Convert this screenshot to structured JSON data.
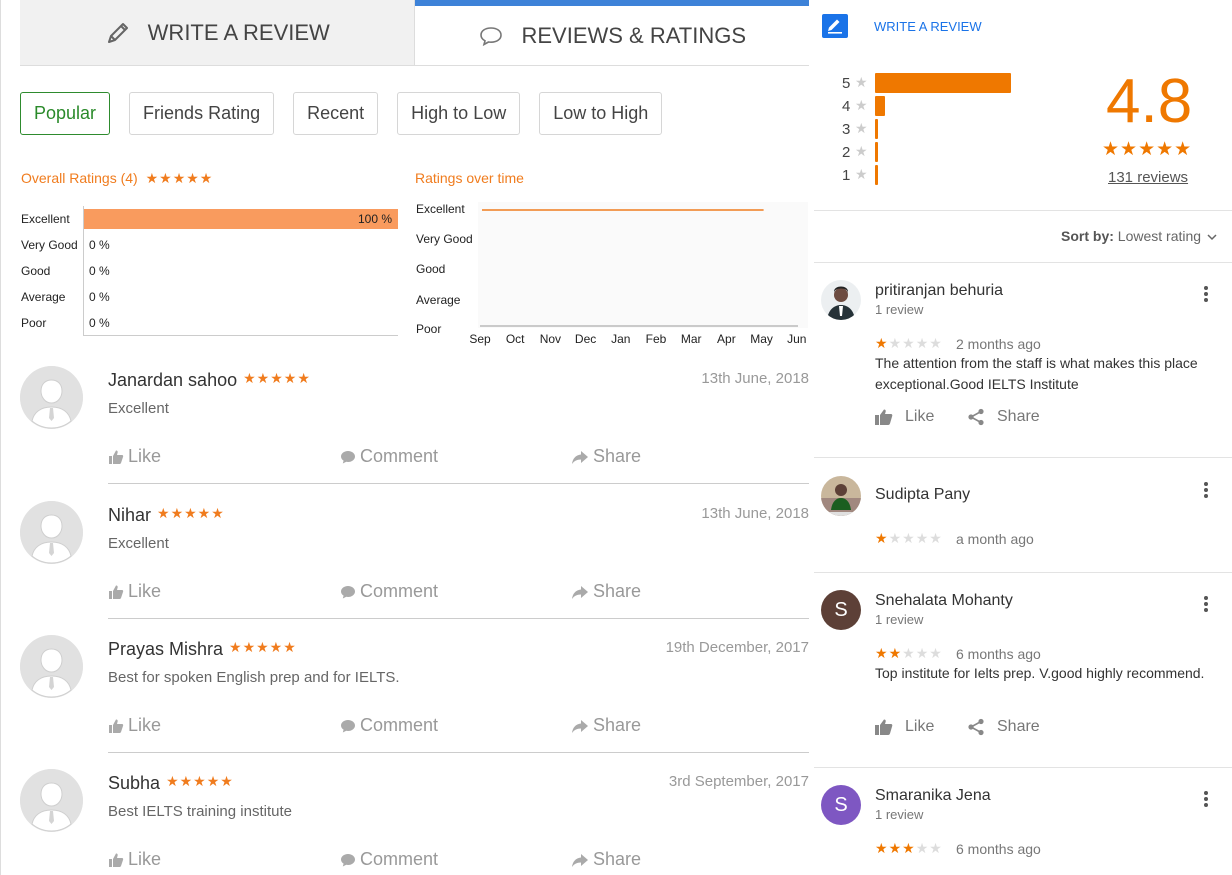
{
  "tabs": {
    "write_review": "WRITE A REVIEW",
    "reviews_ratings": "REVIEWS & RATINGS"
  },
  "filters": [
    "Popular",
    "Friends Rating",
    "Recent",
    "High to Low",
    "Low to High"
  ],
  "overall": {
    "title": "Overall Ratings (4)",
    "stars": "★★★★★"
  },
  "overtime": {
    "title": "Ratings over time"
  },
  "chart_data": [
    {
      "type": "bar",
      "title": "Overall Ratings (4)",
      "categories": [
        "Excellent",
        "Very Good",
        "Good",
        "Average",
        "Poor"
      ],
      "values": [
        100,
        0,
        0,
        0,
        0
      ],
      "value_labels": [
        "100 %",
        "0 %",
        "0 %",
        "0 %",
        "0 %"
      ],
      "orientation": "horizontal",
      "color": "#f99b5e"
    },
    {
      "type": "line",
      "title": "Ratings over time",
      "x": [
        "Sep",
        "Oct",
        "Nov",
        "Dec",
        "Jan",
        "Feb",
        "Mar",
        "Apr",
        "May",
        "Jun"
      ],
      "y_categories": [
        "Excellent",
        "Very Good",
        "Good",
        "Average",
        "Poor"
      ],
      "series": [
        {
          "values": [
            "Excellent",
            "Excellent",
            "Excellent",
            "Excellent",
            "Excellent",
            "Excellent",
            "Excellent",
            "Excellent",
            "Excellent"
          ]
        }
      ],
      "color": "#f07c1e"
    }
  ],
  "reviews": [
    {
      "name": "Janardan sahoo",
      "stars": "★★★★★",
      "date": "13th June, 2018",
      "text": "Excellent",
      "like": "Like",
      "comment": "Comment",
      "share": "Share"
    },
    {
      "name": "Nihar",
      "stars": "★★★★★",
      "date": "13th June, 2018",
      "text": "Excellent",
      "like": "Like",
      "comment": "Comment",
      "share": "Share"
    },
    {
      "name": "Prayas Mishra",
      "stars": "★★★★★",
      "date": "19th December, 2017",
      "text": "Best for spoken English prep and for IELTS.",
      "like": "Like",
      "comment": "Comment",
      "share": "Share"
    },
    {
      "name": "Subha",
      "stars": "★★★★★",
      "date": "3rd September, 2017",
      "text": "Best IELTS training institute",
      "like": "Like",
      "comment": "Comment",
      "share": "Share"
    }
  ],
  "google": {
    "write_review": "WRITE A REVIEW",
    "distribution": [
      {
        "star": "5",
        "value": 0.8
      },
      {
        "star": "4",
        "value": 0.06
      },
      {
        "star": "3",
        "value": 0.02
      },
      {
        "star": "2",
        "value": 0.01
      },
      {
        "star": "1",
        "value": 0.02
      }
    ],
    "score": "4.8",
    "stars": "★★★★★",
    "reviews_count": "131 reviews",
    "sort_label": "Sort by:",
    "sort_value": "Lowest rating",
    "reviews": [
      {
        "name": "pritiranjan behuria",
        "sub": "1 review",
        "rating": 1,
        "time": "2 months ago",
        "text": "The attention from the staff is what makes this place exceptional.Good IELTS Institute",
        "like": "Like",
        "share": "Share",
        "avatar": "photo"
      },
      {
        "name": "Sudipta Pany",
        "sub": "",
        "rating": 1,
        "time": "a month ago",
        "text": "",
        "avatar": "photo"
      },
      {
        "name": "Snehalata Mohanty",
        "sub": "1 review",
        "rating": 2,
        "time": "6 months ago",
        "text": "Top institute for Ielts prep. V.good highly recommend.",
        "like": "Like",
        "share": "Share",
        "avatar": "S",
        "avatar_color": "#5d4037"
      },
      {
        "name": "Smaranika Jena",
        "sub": "1 review",
        "rating": 3,
        "time": "6 months ago",
        "text": "",
        "avatar": "S",
        "avatar_color": "#7e57c2"
      }
    ]
  },
  "icons": {
    "pencil": "pencil-icon",
    "speech": "speech-bubble-icon",
    "thumb": "thumbs-up-icon",
    "comment": "comment-icon",
    "share": "share-icon",
    "menu": "more-vert-icon",
    "chevron": "chevron-down-icon"
  }
}
